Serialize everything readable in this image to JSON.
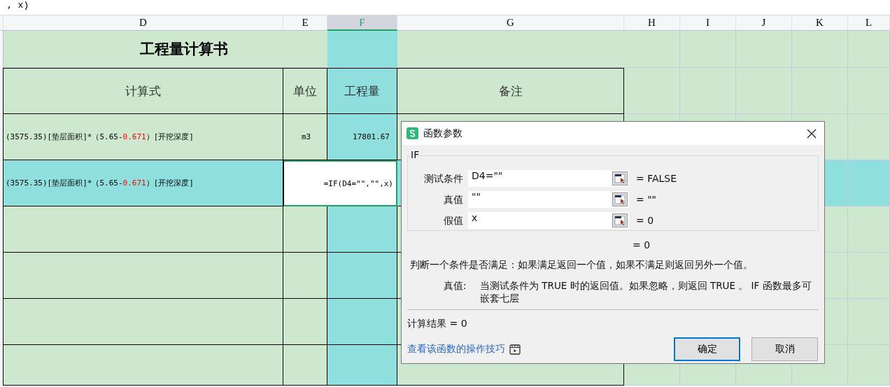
{
  "formula_bar": {
    "text": ", x)"
  },
  "columns": [
    {
      "label": "D",
      "selected": false
    },
    {
      "label": "E",
      "selected": false
    },
    {
      "label": "F",
      "selected": true
    },
    {
      "label": "G",
      "selected": false
    },
    {
      "label": "H",
      "selected": false
    },
    {
      "label": "I",
      "selected": false
    },
    {
      "label": "J",
      "selected": false
    },
    {
      "label": "K",
      "selected": false
    },
    {
      "label": "L",
      "selected": false
    }
  ],
  "sheet": {
    "title": "工程量计算书",
    "headers": [
      "计算式",
      "单位",
      "工程量",
      "备注"
    ],
    "rows": [
      {
        "formula": {
          "before": "(3575.35)[垫层面积]*（5.65-",
          "highlight": "0.671",
          "after": "）[开挖深度]"
        },
        "unit": "m3",
        "quantity": "17801.67",
        "selected": false
      },
      {
        "formula": {
          "before": "(3575.35)[垫层面积]*（5.65-",
          "highlight": "0.671",
          "after": "）[开挖深度]"
        },
        "editing": "=IF(D4=\"\",\"\",x)",
        "selected": true
      }
    ]
  },
  "dialog": {
    "title": "函数参数",
    "function_name": "IF",
    "args": [
      {
        "label": "测试条件",
        "value": "D4=\"\"",
        "result": "= FALSE"
      },
      {
        "label": "真值",
        "value": "\"\"",
        "result": "= \"\""
      },
      {
        "label": "假值",
        "value": "x",
        "result": "= 0"
      }
    ],
    "overall_result": "= 0",
    "description": "判断一个条件是否满足：如果满足返回一个值，如果不满足则返回另外一个值。",
    "param_help": {
      "label": "真值:",
      "text": "当测试条件为 TRUE 时的返回值。如果忽略，则返回 TRUE 。 IF 函数最多可嵌套七层"
    },
    "calc_result": "计算结果 = 0",
    "link": "查看该函数的操作技巧",
    "buttons": [
      {
        "label": "确定",
        "primary": true
      },
      {
        "label": "取消",
        "primary": false
      }
    ]
  }
}
